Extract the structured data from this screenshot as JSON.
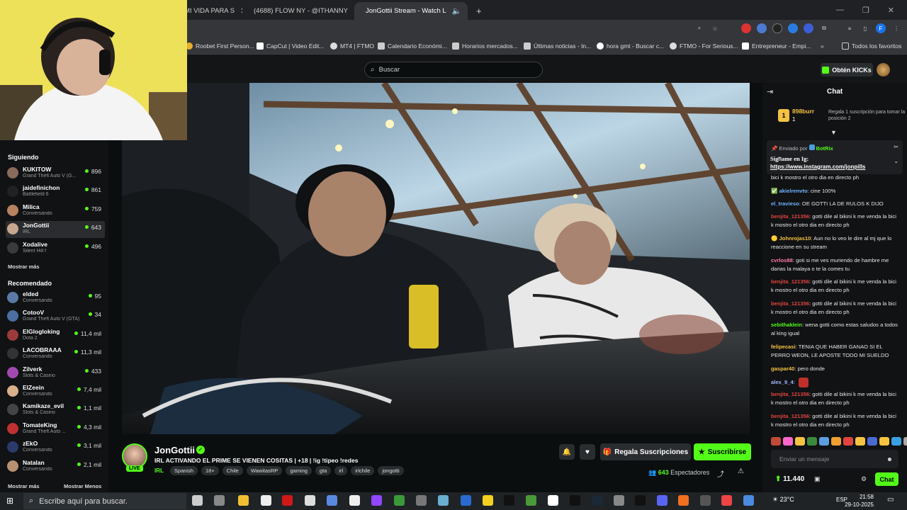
{
  "browser": {
    "tabs": [
      {
        "label": "MI VIDA PARA S",
        "color": "#ff4444"
      },
      {
        "label": "(4688) FLOW NY - @ITHANNY",
        "color": "#ff0000"
      },
      {
        "label": "JonGottii Stream - Watch L",
        "color": "#53fc18"
      }
    ],
    "new_tab": "+",
    "bookmarks": [
      "Roobet First Person...",
      "CapCut | Video Edit...",
      "MT4 | FTMO",
      "Calendario Económi...",
      "Horarios mercados...",
      "Últimas noticias - In...",
      "hora gmt - Buscar c...",
      "FTMO - For Serious...",
      "Entrepreneur - Empi...",
      "Todos los favoritos"
    ]
  },
  "header": {
    "search_placeholder": "Buscar",
    "kicks_label": "Obtén KICKs"
  },
  "sidebar": {
    "following_title": "Siguiendo",
    "following": [
      {
        "name": "KUKITOW",
        "game": "Grand Theft Auto V (G...",
        "viewers": "896",
        "color": "#8a6a5a"
      },
      {
        "name": "jaidefinichon",
        "game": "Battlefield 6",
        "viewers": "861",
        "color": "#222"
      },
      {
        "name": "Milica",
        "game": "Conversando",
        "viewers": "759",
        "color": "#b7825f"
      },
      {
        "name": "JonGottii",
        "game": "IRL",
        "viewers": "643",
        "color": "#c9a68e"
      },
      {
        "name": "Xodalive",
        "game": "Silent Hill f",
        "viewers": "496",
        "color": "#3a3a3a"
      }
    ],
    "show_more": "Mostrar más",
    "recommended_title": "Recomendado",
    "recommended": [
      {
        "name": "elded",
        "game": "Conversando",
        "viewers": "95",
        "color": "#5a7aa5"
      },
      {
        "name": "CotooV",
        "game": "Grand Theft Auto V (GTA)",
        "viewers": "34",
        "color": "#4a6fa0"
      },
      {
        "name": "ElGlogloking",
        "game": "Dota 2",
        "viewers": "11,4 mil",
        "color": "#9c3a3a"
      },
      {
        "name": "LACOBRAAA",
        "game": "Conversando",
        "viewers": "11,3 mil",
        "color": "#333"
      },
      {
        "name": "Zilverk",
        "game": "Slots & Casino",
        "viewers": "433",
        "color": "#a04ab0"
      },
      {
        "name": "ElZeein",
        "game": "Conversando",
        "viewers": "7,4 mil",
        "color": "#d8b08a"
      },
      {
        "name": "Kamikaze_evil",
        "game": "Slots & Casino",
        "viewers": "1,1 mil",
        "color": "#444"
      },
      {
        "name": "TomateKing",
        "game": "Grand Theft Auto ...",
        "viewers": "4,3 mil",
        "color": "#c03030"
      },
      {
        "name": "zEkO",
        "game": "Conversando",
        "viewers": "3,1 mil",
        "color": "#2a3a6a"
      },
      {
        "name": "Natalan",
        "game": "Conversando",
        "viewers": "2,1 mil",
        "color": "#b89070"
      }
    ],
    "show_more_bottom": "Mostrar más",
    "show_less": "Mostrar Menos"
  },
  "stream": {
    "live_badge": "LIVE",
    "streamer": "JonGottii",
    "title": "IRL ACTIVANDO EL PRIME SE VIENEN COSITAS | +18 | !ig !tipeo !redes",
    "category": "IRL",
    "tags": [
      "Spanish",
      "18+",
      "Chile",
      "WawitasRP",
      "gaming",
      "gta",
      "irl",
      "irlchile",
      "jongotti"
    ],
    "gift_label": "Regala Suscripciones",
    "subscribe_label": "Suscribirse",
    "viewers": "643",
    "viewers_label": "Espectadores"
  },
  "chat": {
    "title": "Chat",
    "leader_name": "898burr",
    "leader_count": "1",
    "leader_rank": "1",
    "leader_note": "Regala 1 suscripción para tomar la posición 2",
    "pinned_by_label": "Enviado por",
    "pinned_by": "BotRix",
    "pinned_title": "Sigᥒame en Ig:",
    "pinned_link": "https://www.instagram.com/jonpills",
    "messages": [
      {
        "user": "",
        "text": "bici k mostro el otro dia en directo ph",
        "color": "#e6e6e6"
      },
      {
        "user": "akielrenvto",
        "text": "cine 100%",
        "color": "#6fb3ff"
      },
      {
        "user": "el_travieso",
        "text": "OE GOTTI LA DE RULOS K DIJO",
        "color": "#6fb3ff"
      },
      {
        "user": "benjita_121356",
        "text": "gotti dile al bikini k me venda la bici k mostro el otro dia en directo ph",
        "color": "#e0443c"
      },
      {
        "user": "Johnrojas10",
        "text": "Aun no lo veo le dire al mj que lo reaccione en su stream",
        "color": "#f5c242"
      },
      {
        "user": "cvrlos88",
        "text": "goti si me ves muriendo de hambre me darias la malaya o te la comes tu",
        "color": "#ff7aa8"
      },
      {
        "user": "benjita_121356",
        "text": "gotti dile al bikini k me venda la bici k mostro el otro dia en directo ph",
        "color": "#e0443c"
      },
      {
        "user": "benjita_121356",
        "text": "gotti dile al bikini k me venda la bici k mostro el otro dia en directo ph",
        "color": "#e0443c"
      },
      {
        "user": "sebithaklein",
        "text": "wena gotti como estas saludos a todos al king igual",
        "color": "#53fc18"
      },
      {
        "user": "felipecasi",
        "text": "TENIA QUE HABER GANAO SI EL PERRO WEON, LE APOSTE TODO MI SUELDO",
        "color": "#f5c242"
      },
      {
        "user": "gaspar40",
        "text": "pero donde",
        "color": "#f5c242"
      },
      {
        "user": "alex_9_4",
        "text": "",
        "color": "#9fb8ff"
      },
      {
        "user": "benjita_121356",
        "text": "gotti dile al bikini k me venda la bici k mostro el otro dia en directo ph",
        "color": "#e0443c"
      },
      {
        "user": "benjita_121356",
        "text": "gotti dile al bikini k me venda la bici k mostro el otro dia en directo ph",
        "color": "#e0443c"
      }
    ],
    "input_placeholder": "Enviar un mensaje",
    "points": "11.440",
    "send_label": "Chat"
  },
  "taskbar": {
    "search_placeholder": "Escribe aquí para buscar.",
    "weather": "23°C",
    "language": "ESP",
    "time": "21:58",
    "date": "29-10-2025"
  },
  "colors": {
    "accent": "#53fc18",
    "bg": "#0b0e0f",
    "panel": "#101214"
  }
}
